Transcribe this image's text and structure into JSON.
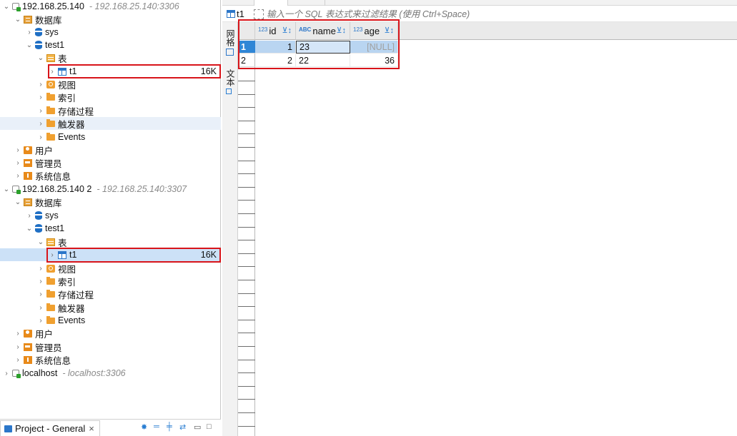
{
  "navigator": {
    "conn1": {
      "name": "192.168.25.140",
      "sub": "- 192.168.25.140:3306"
    },
    "conn2": {
      "name": "192.168.25.140 2",
      "sub": "- 192.168.25.140:3307"
    },
    "conn3": {
      "name": "localhost",
      "sub": "- localhost:3306"
    },
    "databases": "数据库",
    "sys": "sys",
    "test1": "test1",
    "tables": "表",
    "t1": "t1",
    "t1_size": "16K",
    "views": "视图",
    "indexes": "索引",
    "procedures": "存储过程",
    "triggers": "触发器",
    "events": "Events",
    "users": "用户",
    "admins": "管理员",
    "sysinfo": "系统信息"
  },
  "project_tab": {
    "label": "Project - General",
    "close": "×"
  },
  "editor": {
    "table_name": "t1",
    "filter_placeholder": "输入一个 SQL 表达式来过滤结果 (使用 Ctrl+Space)",
    "side_tabs": [
      "网格",
      "文本"
    ],
    "columns": [
      {
        "type": "123",
        "name": "id"
      },
      {
        "type": "ABC",
        "name": "name"
      },
      {
        "type": "123",
        "name": "age"
      }
    ],
    "rows": [
      {
        "num": "1",
        "id": "1",
        "name": "23",
        "age": "[NULL]"
      },
      {
        "num": "2",
        "id": "2",
        "name": "22",
        "age": "36"
      }
    ]
  },
  "colors": {
    "selection": "#2f86d6",
    "highlight_box": "#d8141a",
    "accent": "#2b76c9"
  }
}
